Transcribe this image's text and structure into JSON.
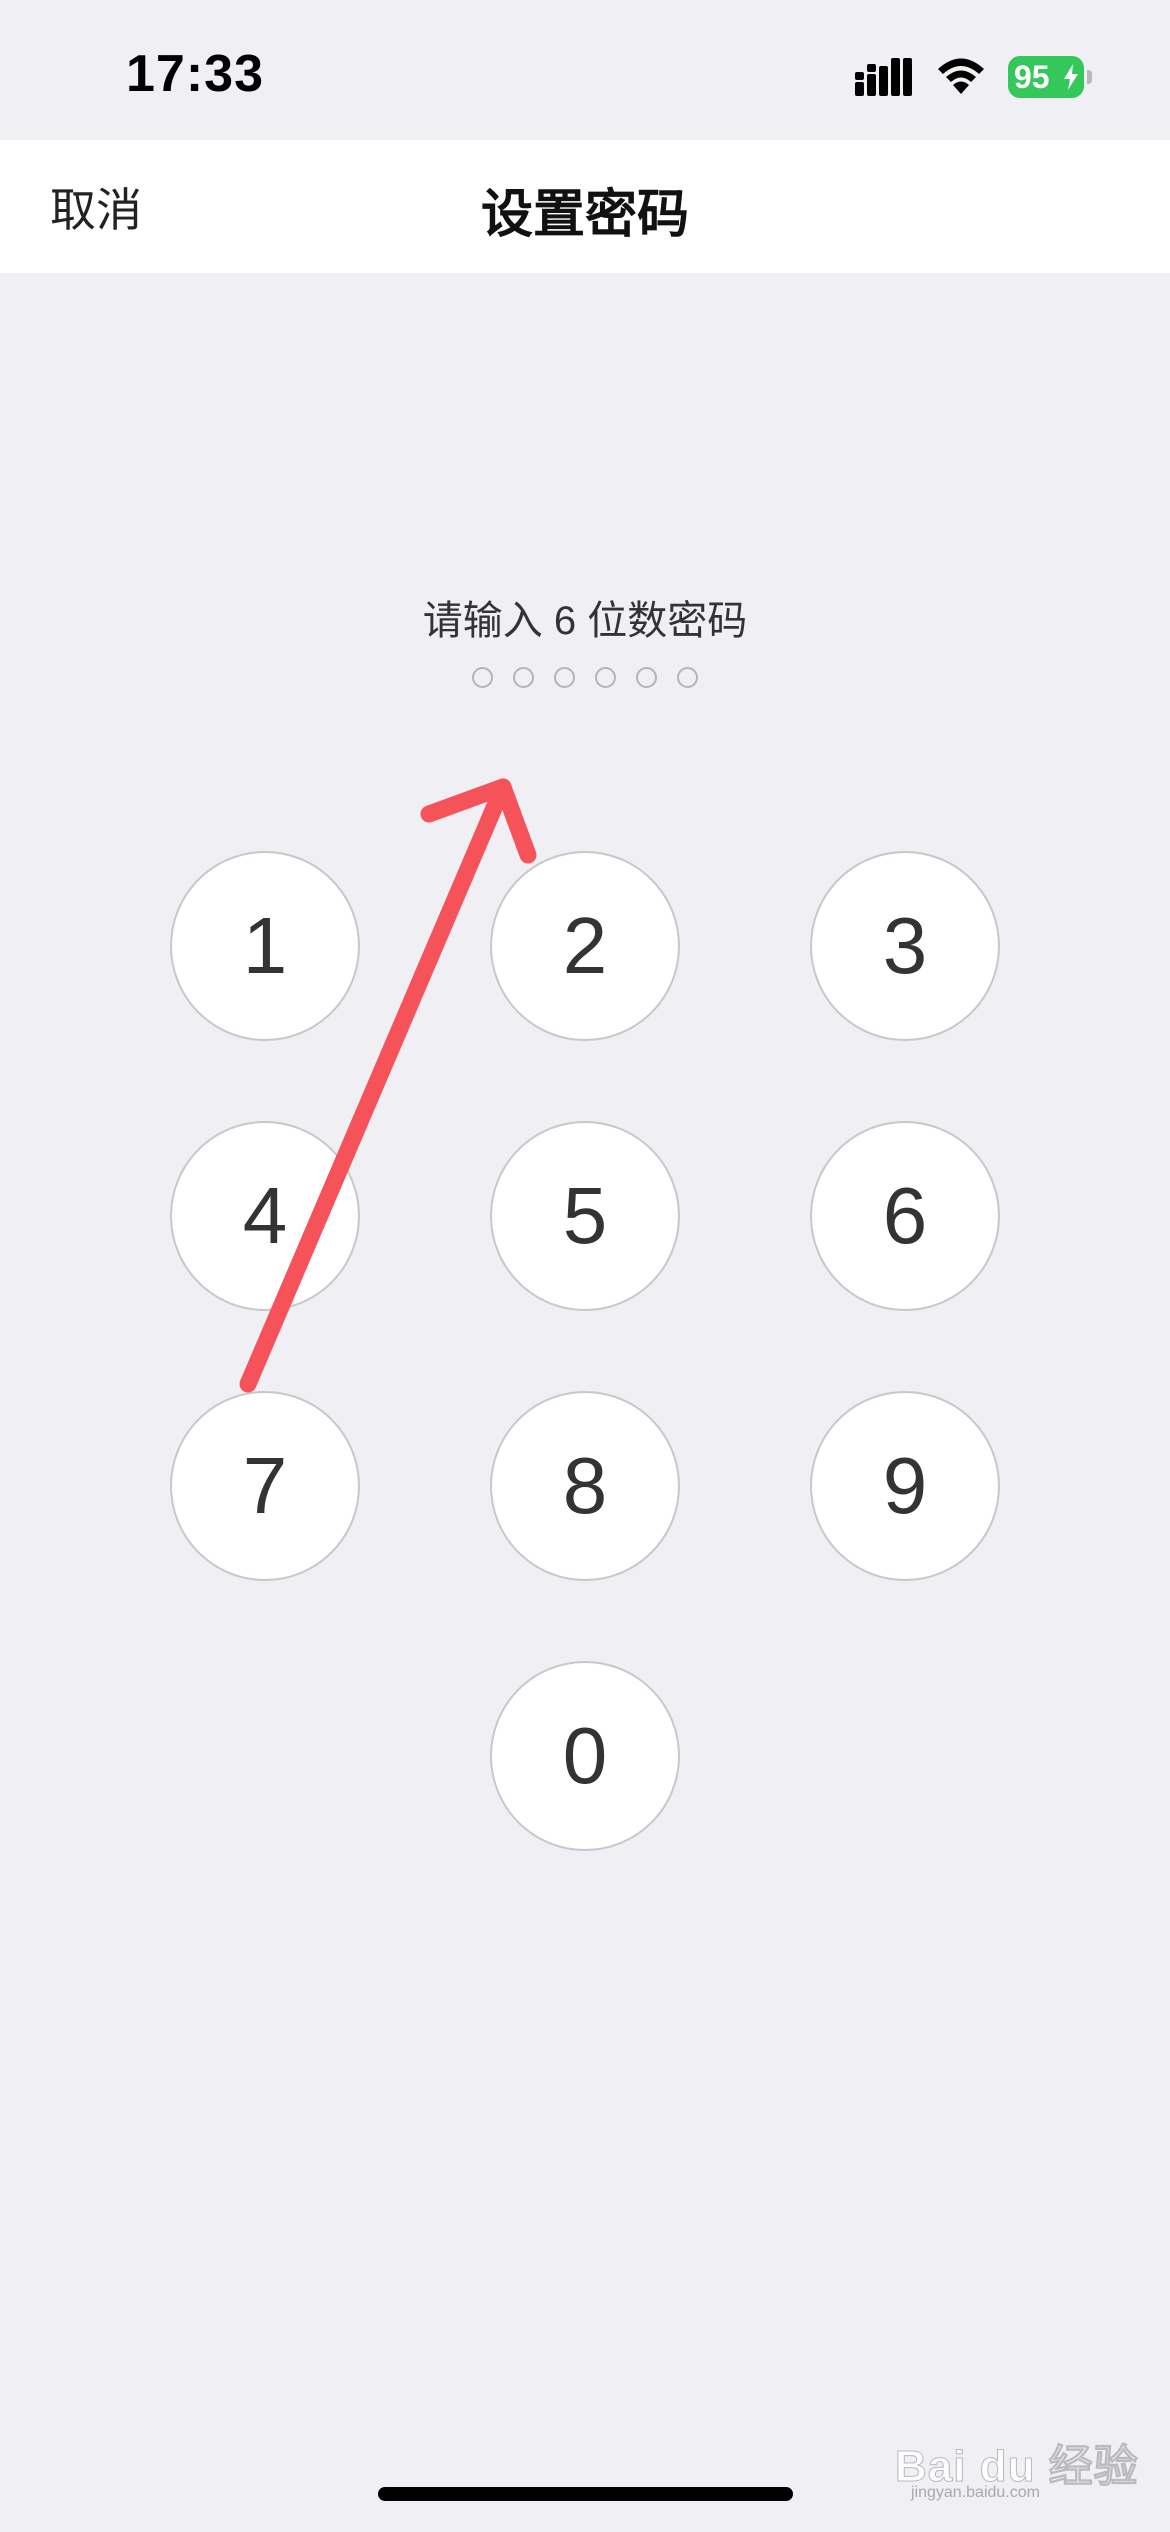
{
  "status_bar": {
    "time": "17:33",
    "battery_level": "95",
    "icons": [
      "signal-icon",
      "wifi-icon",
      "battery-icon",
      "charging-bolt-icon"
    ],
    "battery_color": "#34c759"
  },
  "nav": {
    "cancel_label": "取消",
    "title": "设置密码"
  },
  "prompt": "请输入 6 位数密码",
  "passcode": {
    "length": 6,
    "filled": 0
  },
  "keypad": {
    "keys": [
      "1",
      "2",
      "3",
      "4",
      "5",
      "6",
      "7",
      "8",
      "9",
      "0"
    ]
  },
  "annotation": {
    "type": "arrow",
    "color": "#f5525a"
  },
  "watermark": {
    "text": "Bai du 经验",
    "sub": "jingyan.baidu.com"
  }
}
